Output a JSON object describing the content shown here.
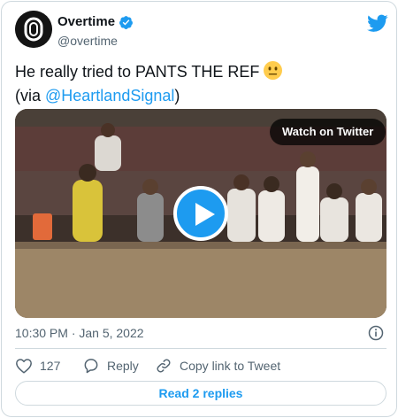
{
  "author": {
    "display_name": "Overtime",
    "handle": "@overtime",
    "verified": true,
    "avatar_icon": "overtime-logo-icon"
  },
  "tweet": {
    "text": "He really tried to PANTS THE REF",
    "emoji": "neutral-face-emoji",
    "via_prefix": "(via ",
    "mention": "@HeartlandSignal",
    "via_suffix": ")"
  },
  "media": {
    "watch_label": "Watch on Twitter",
    "play_icon": "play-icon"
  },
  "meta": {
    "timestamp": "10:30 PM · Jan 5, 2022"
  },
  "actions": {
    "like_count": "127",
    "reply_label": "Reply",
    "copy_label": "Copy link to Tweet"
  },
  "replies": {
    "label": "Read 2 replies"
  },
  "colors": {
    "accent": "#1d9bf0",
    "text": "#0f1419",
    "muted": "#536471",
    "border": "#cfd9de"
  }
}
